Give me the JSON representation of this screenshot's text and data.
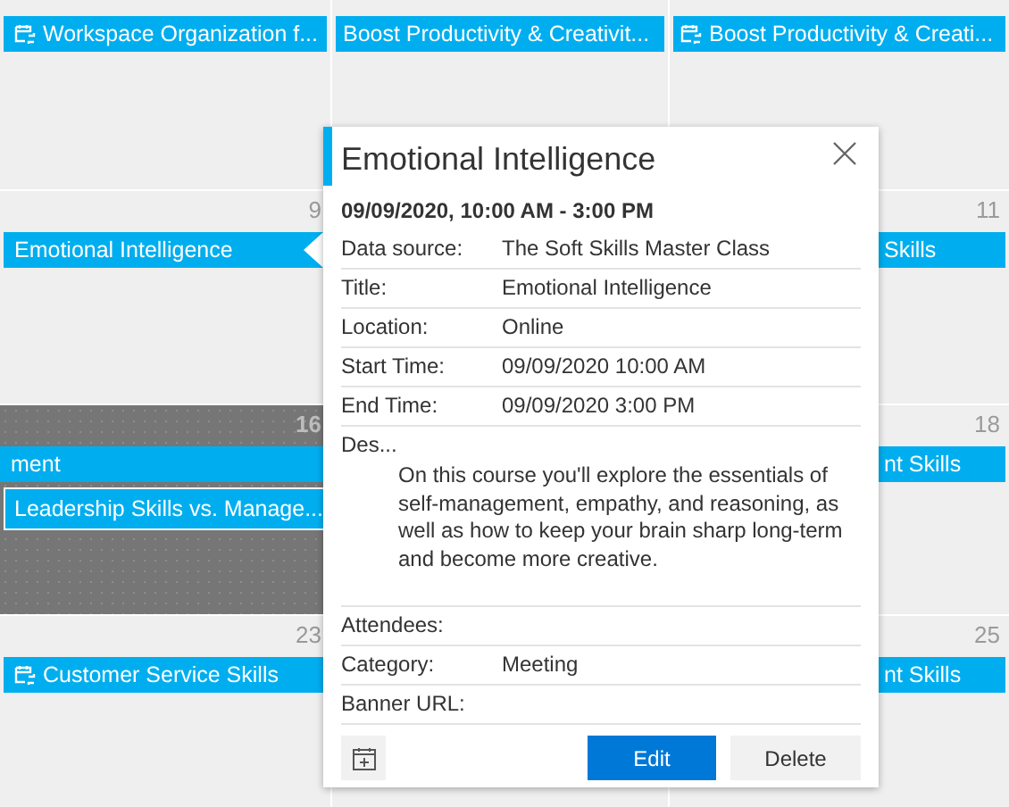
{
  "calendar": {
    "weeks": [
      {
        "days": [
          {
            "selected": false,
            "events": [
              {
                "title": "Workspace Organization f...",
                "recurring": true,
                "focused": false
              }
            ]
          },
          {
            "selected": false,
            "events": [
              {
                "title": "Boost Productivity & Creativit...",
                "recurring": false,
                "focused": false
              }
            ]
          },
          {
            "selected": false,
            "events": [
              {
                "title": "Boost Productivity & Creati...",
                "recurring": true,
                "focused": false
              }
            ]
          }
        ]
      },
      {
        "days": [
          {
            "date": "9",
            "selected": false,
            "events": [
              {
                "title": "Emotional Intelligence",
                "recurring": false,
                "focused": false
              }
            ]
          },
          {
            "date": "11",
            "selected": false,
            "events": [
              {
                "title": "Skills",
                "recurring": false,
                "focused": false
              }
            ]
          }
        ]
      },
      {
        "days": [
          {
            "date": "16",
            "selected": true,
            "events": [
              {
                "title": "ment",
                "recurring": false,
                "focused": false
              },
              {
                "title": "Leadership Skills vs. Manage...",
                "recurring": false,
                "focused": true
              }
            ]
          },
          {
            "date": "18",
            "selected": false,
            "events": [
              {
                "title": "nt Skills",
                "recurring": false,
                "focused": false
              }
            ]
          }
        ]
      },
      {
        "days": [
          {
            "date": "23",
            "selected": false,
            "events": [
              {
                "title": "Customer Service Skills",
                "recurring": true,
                "focused": false
              }
            ]
          },
          {
            "selected": false
          },
          {
            "date": "25",
            "selected": false,
            "events": [
              {
                "title": "nt Skills",
                "recurring": false,
                "focused": false
              }
            ]
          }
        ]
      }
    ]
  },
  "popup": {
    "title": "Emotional Intelligence",
    "when": "09/09/2020, 10:00 AM - 3:00 PM",
    "fields": [
      {
        "label": "Data source:",
        "value": "The Soft Skills Master Class"
      },
      {
        "label": "Title:",
        "value": "Emotional Intelligence"
      },
      {
        "label": "Location:",
        "value": "Online"
      },
      {
        "label": "Start Time:",
        "value": "09/09/2020 10:00 AM"
      },
      {
        "label": "End Time:",
        "value": "09/09/2020 3:00 PM"
      },
      {
        "label": "Des...",
        "value": "On this course you'll explore the essentials of self-management, empathy, and reasoning, as well as how to keep your brain sharp long-term and become more creative.",
        "kind": "block"
      },
      {
        "label": "Attendees:"
      },
      {
        "label": "Category:",
        "value": "Meeting"
      },
      {
        "label": "Banner URL:"
      }
    ],
    "buttons": [
      {
        "label": "Edit",
        "primary": true
      },
      {
        "label": "Delete",
        "primary": false
      }
    ]
  }
}
